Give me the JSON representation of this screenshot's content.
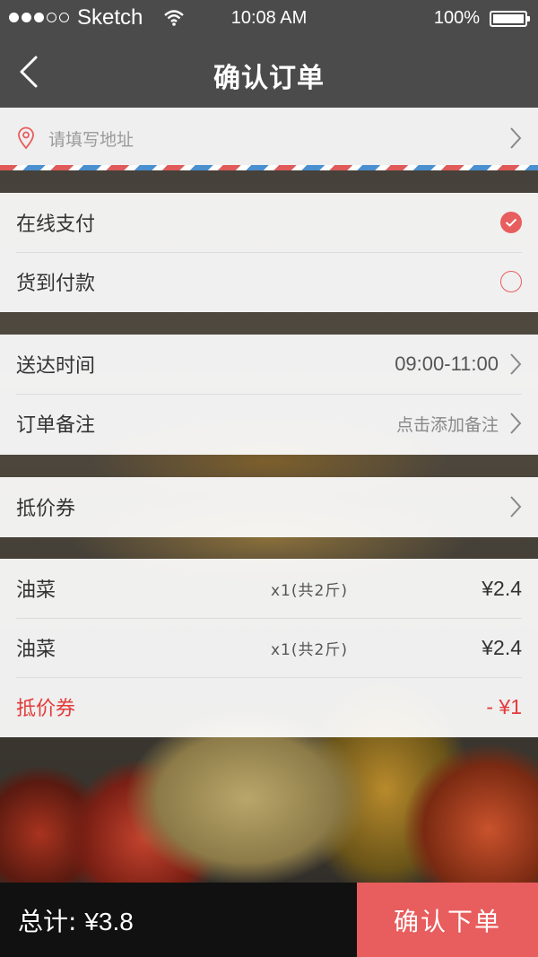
{
  "status_bar": {
    "carrier": "Sketch",
    "time": "10:08 AM",
    "battery": "100%"
  },
  "nav": {
    "title": "确认订单",
    "back_icon": "chevron-left-icon"
  },
  "address": {
    "placeholder": "请填写地址",
    "icon": "location-pin-icon"
  },
  "payment": {
    "online": {
      "label": "在线支付",
      "selected": true
    },
    "cod": {
      "label": "货到付款",
      "selected": false
    }
  },
  "delivery": {
    "time_label": "送达时间",
    "time_value": "09:00-11:00",
    "note_label": "订单备注",
    "note_hint": "点击添加备注"
  },
  "coupon": {
    "label": "抵价券"
  },
  "items": [
    {
      "name": "油菜",
      "qty": "x1(共2斤)",
      "price": "¥2.4"
    },
    {
      "name": "油菜",
      "qty": "x1(共2斤)",
      "price": "¥2.4"
    }
  ],
  "discount": {
    "label": "抵价券",
    "amount": "- ¥1"
  },
  "footer": {
    "total_label": "总计:",
    "total_value": "¥3.8",
    "submit_label": "确认下单"
  },
  "colors": {
    "accent": "#e85d5d",
    "bar": "#4b4b4b",
    "discount_text": "#e33b3b"
  }
}
